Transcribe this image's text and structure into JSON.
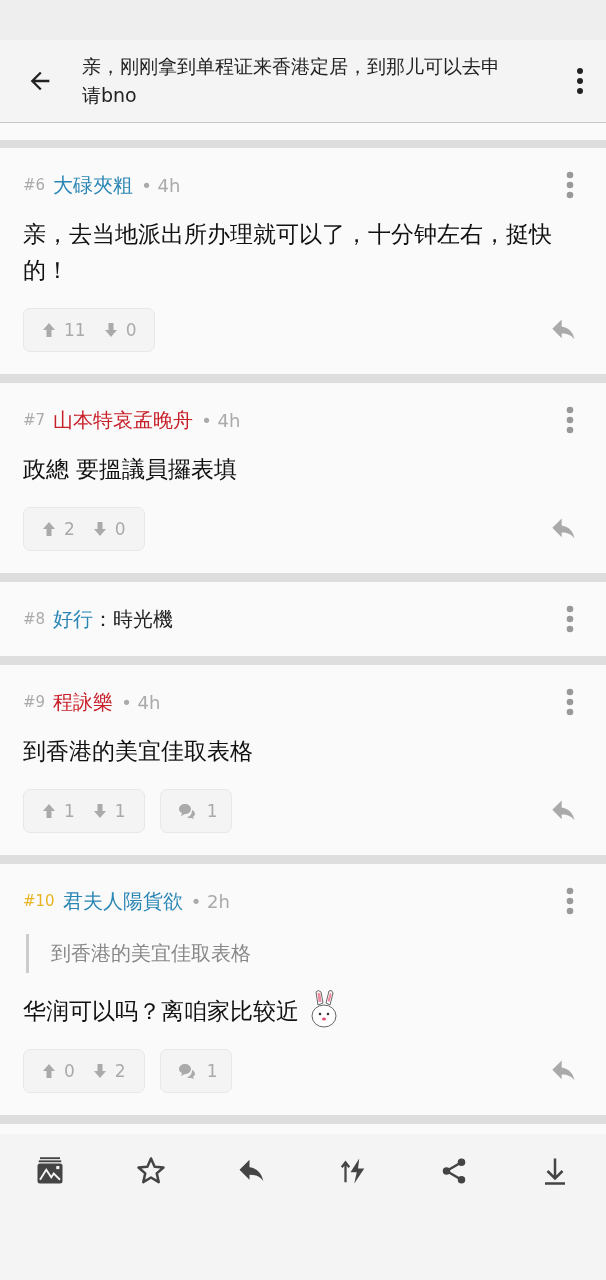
{
  "header": {
    "title": "亲，刚刚拿到单程证来香港定居，到那儿可以去申请bno"
  },
  "posts": [
    {
      "kind": "full",
      "number": "#6",
      "highlighted": false,
      "author": "大碌夾粗",
      "color": "#2a86b4",
      "time": "• 4h",
      "content": "亲，去当地派出所办理就可以了，十分钟左右，挺快的！",
      "upvotes": "11",
      "downvotes": "0"
    },
    {
      "kind": "full",
      "number": "#7",
      "highlighted": false,
      "author": "山本特哀孟晚舟",
      "color": "#c8202a",
      "time": "• 4h",
      "content": "政總 要搵議員攞表填",
      "upvotes": "2",
      "downvotes": "0"
    },
    {
      "kind": "collapsed",
      "number": "#8",
      "highlighted": false,
      "author": "好行",
      "color": "#2a86b4",
      "snippet": "：時光機"
    },
    {
      "kind": "full",
      "number": "#9",
      "highlighted": false,
      "author": "程詠樂",
      "color": "#c8202a",
      "time": "• 4h",
      "content": "到香港的美宜佳取表格",
      "upvotes": "1",
      "downvotes": "1",
      "comments": "1"
    },
    {
      "kind": "full",
      "number": "#10",
      "highlighted": true,
      "author": "君夫人陽貨欲",
      "color": "#2a86b4",
      "time": "• 2h",
      "quote": "到香港的美宜佳取表格",
      "content": "华润可以吗？离咱家比较近",
      "sticker": true,
      "upvotes": "0",
      "downvotes": "2",
      "comments": "1"
    }
  ]
}
